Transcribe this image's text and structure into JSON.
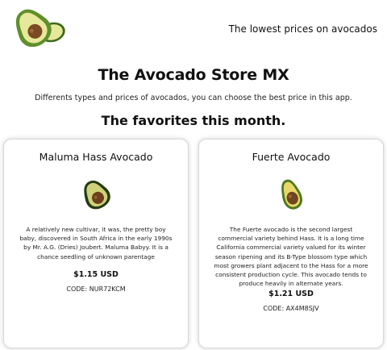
{
  "header": {
    "logo_icon": "avocado-logo-icon",
    "tagline": "The lowest prices on avocados"
  },
  "main": {
    "title": "The Avocado Store MX",
    "subtitle": "Differents types and prices of avocados, you can choose the best price in this app.",
    "section_title": "The favorites this month."
  },
  "products": [
    {
      "name": "Maluma Hass Avocado",
      "image_icon": "hass-avocado-icon",
      "description": "A relatively new cultivar, it was, the pretty boy baby, discovered in South Africa in the early 1990s by Mr. A.G. (Dries) Joubert. Maluma Babyy. It is a chance seedling of unknown parentage",
      "price": "$1.15 USD",
      "code": "CODE: NUR72KCM"
    },
    {
      "name": "Fuerte Avocado",
      "image_icon": "fuerte-avocado-icon",
      "description": "The Fuerte avocado is the second largest commercial variety behind Hass. It is a long time California commercial variety valued for its winter season ripening and its B-Type blossom type which most growers plant adjacent to the Hass for a more consistent production cycle. This avocado tends to produce heavily in alternate years.",
      "price": "$1.21 USD",
      "code": "CODE: AX4M8SJV"
    }
  ],
  "colors": {
    "avocado_skin": "#5f8f2b",
    "avocado_flesh": "#e6e89a",
    "avocado_pit": "#7a4a24",
    "card_border": "#d8d8d8"
  }
}
